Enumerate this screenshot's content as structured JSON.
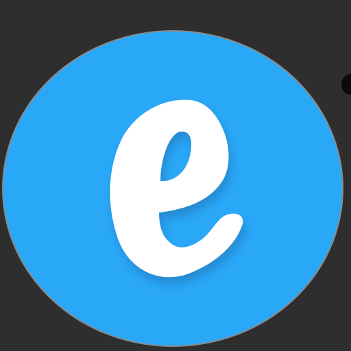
{
  "app_icon": {
    "name": "e-app-logo-icon",
    "background_color": "#2e2e2e",
    "circle_color": "#2aa8f8",
    "circle_border_color": "#8a8a8a",
    "glyph_color": "#ffffff",
    "glyph_shadow_color": "#1a6fb0"
  }
}
